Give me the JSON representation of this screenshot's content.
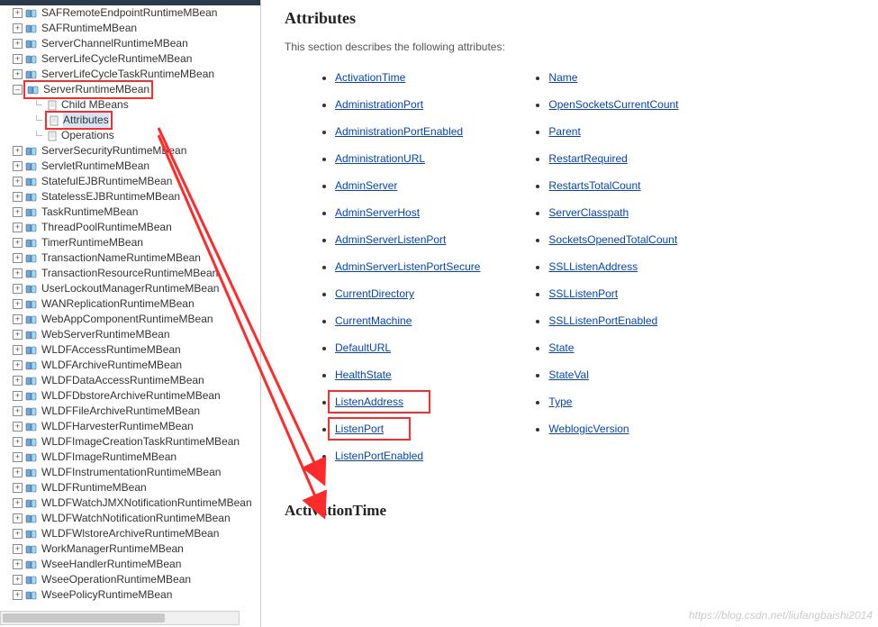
{
  "sidebar": {
    "items": [
      {
        "exp": "plus",
        "label": "SAFRemoteEndpointRuntimeMBean",
        "indent": 0,
        "icon": "book"
      },
      {
        "exp": "plus",
        "label": "SAFRuntimeMBean",
        "indent": 0,
        "icon": "book"
      },
      {
        "exp": "plus",
        "label": "ServerChannelRuntimeMBean",
        "indent": 0,
        "icon": "book"
      },
      {
        "exp": "plus",
        "label": "ServerLifeCycleRuntimeMBean",
        "indent": 0,
        "icon": "book"
      },
      {
        "exp": "plus",
        "label": "ServerLifeCycleTaskRuntimeMBean",
        "indent": 0,
        "icon": "book"
      },
      {
        "exp": "minus",
        "label": "ServerRuntimeMBean",
        "indent": 0,
        "icon": "book",
        "highlight": true
      },
      {
        "exp": "dot",
        "label": "Child MBeans",
        "indent": 1,
        "icon": "page"
      },
      {
        "exp": "dot",
        "label": "Attributes",
        "indent": 1,
        "icon": "page",
        "highlight": true,
        "active": true
      },
      {
        "exp": "dot",
        "label": "Operations",
        "indent": 1,
        "icon": "page"
      },
      {
        "exp": "plus",
        "label": "ServerSecurityRuntimeMBean",
        "indent": 0,
        "icon": "book"
      },
      {
        "exp": "plus",
        "label": "ServletRuntimeMBean",
        "indent": 0,
        "icon": "book"
      },
      {
        "exp": "plus",
        "label": "StatefulEJBRuntimeMBean",
        "indent": 0,
        "icon": "book"
      },
      {
        "exp": "plus",
        "label": "StatelessEJBRuntimeMBean",
        "indent": 0,
        "icon": "book"
      },
      {
        "exp": "plus",
        "label": "TaskRuntimeMBean",
        "indent": 0,
        "icon": "book"
      },
      {
        "exp": "plus",
        "label": "ThreadPoolRuntimeMBean",
        "indent": 0,
        "icon": "book"
      },
      {
        "exp": "plus",
        "label": "TimerRuntimeMBean",
        "indent": 0,
        "icon": "book"
      },
      {
        "exp": "plus",
        "label": "TransactionNameRuntimeMBean",
        "indent": 0,
        "icon": "book"
      },
      {
        "exp": "plus",
        "label": "TransactionResourceRuntimeMBean",
        "indent": 0,
        "icon": "book"
      },
      {
        "exp": "plus",
        "label": "UserLockoutManagerRuntimeMBean",
        "indent": 0,
        "icon": "book"
      },
      {
        "exp": "plus",
        "label": "WANReplicationRuntimeMBean",
        "indent": 0,
        "icon": "book"
      },
      {
        "exp": "plus",
        "label": "WebAppComponentRuntimeMBean",
        "indent": 0,
        "icon": "book"
      },
      {
        "exp": "plus",
        "label": "WebServerRuntimeMBean",
        "indent": 0,
        "icon": "book"
      },
      {
        "exp": "plus",
        "label": "WLDFAccessRuntimeMBean",
        "indent": 0,
        "icon": "book"
      },
      {
        "exp": "plus",
        "label": "WLDFArchiveRuntimeMBean",
        "indent": 0,
        "icon": "book"
      },
      {
        "exp": "plus",
        "label": "WLDFDataAccessRuntimeMBean",
        "indent": 0,
        "icon": "book"
      },
      {
        "exp": "plus",
        "label": "WLDFDbstoreArchiveRuntimeMBean",
        "indent": 0,
        "icon": "book"
      },
      {
        "exp": "plus",
        "label": "WLDFFileArchiveRuntimeMBean",
        "indent": 0,
        "icon": "book"
      },
      {
        "exp": "plus",
        "label": "WLDFHarvesterRuntimeMBean",
        "indent": 0,
        "icon": "book"
      },
      {
        "exp": "plus",
        "label": "WLDFImageCreationTaskRuntimeMBean",
        "indent": 0,
        "icon": "book"
      },
      {
        "exp": "plus",
        "label": "WLDFImageRuntimeMBean",
        "indent": 0,
        "icon": "book"
      },
      {
        "exp": "plus",
        "label": "WLDFInstrumentationRuntimeMBean",
        "indent": 0,
        "icon": "book"
      },
      {
        "exp": "plus",
        "label": "WLDFRuntimeMBean",
        "indent": 0,
        "icon": "book"
      },
      {
        "exp": "plus",
        "label": "WLDFWatchJMXNotificationRuntimeMBean",
        "indent": 0,
        "icon": "book"
      },
      {
        "exp": "plus",
        "label": "WLDFWatchNotificationRuntimeMBean",
        "indent": 0,
        "icon": "book"
      },
      {
        "exp": "plus",
        "label": "WLDFWlstoreArchiveRuntimeMBean",
        "indent": 0,
        "icon": "book"
      },
      {
        "exp": "plus",
        "label": "WorkManagerRuntimeMBean",
        "indent": 0,
        "icon": "book"
      },
      {
        "exp": "plus",
        "label": "WseeHandlerRuntimeMBean",
        "indent": 0,
        "icon": "book"
      },
      {
        "exp": "plus",
        "label": "WseeOperationRuntimeMBean",
        "indent": 0,
        "icon": "book"
      },
      {
        "exp": "plus",
        "label": "WseePolicyRuntimeMBean",
        "indent": 0,
        "icon": "book"
      }
    ]
  },
  "main": {
    "heading": "Attributes",
    "description": "This section describes the following attributes:",
    "col1": [
      {
        "label": "ActivationTime"
      },
      {
        "label": "AdministrationPort"
      },
      {
        "label": "AdministrationPortEnabled"
      },
      {
        "label": "AdministrationURL"
      },
      {
        "label": "AdminServer"
      },
      {
        "label": "AdminServerHost"
      },
      {
        "label": "AdminServerListenPort"
      },
      {
        "label": "AdminServerListenPortSecure"
      },
      {
        "label": "CurrentDirectory"
      },
      {
        "label": "CurrentMachine"
      },
      {
        "label": "DefaultURL"
      },
      {
        "label": "HealthState"
      },
      {
        "label": "ListenAddress",
        "box": true
      },
      {
        "label": "ListenPort",
        "box": true
      },
      {
        "label": "ListenPortEnabled"
      }
    ],
    "col2": [
      {
        "label": "Name"
      },
      {
        "label": "OpenSocketsCurrentCount"
      },
      {
        "label": "Parent"
      },
      {
        "label": "RestartRequired"
      },
      {
        "label": "RestartsTotalCount"
      },
      {
        "label": "ServerClasspath"
      },
      {
        "label": "SocketsOpenedTotalCount"
      },
      {
        "label": "SSLListenAddress"
      },
      {
        "label": "SSLListenPort"
      },
      {
        "label": "SSLListenPortEnabled"
      },
      {
        "label": "State"
      },
      {
        "label": "StateVal"
      },
      {
        "label": "Type"
      },
      {
        "label": "WeblogicVersion"
      }
    ],
    "subheading": "ActivationTime"
  },
  "watermark": "https://blog.csdn.net/liufangbaishi2014"
}
